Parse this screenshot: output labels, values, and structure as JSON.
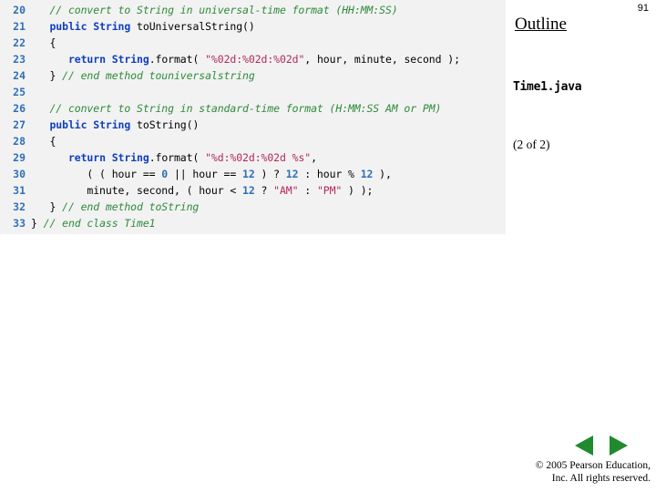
{
  "slide": {
    "number": "91",
    "outline_label": "Outline",
    "file_name": "Time1.java",
    "page_of": "(2 of 2)"
  },
  "code": {
    "lines": [
      {
        "num": "20",
        "tokens": [
          {
            "t": "   ",
            "c": "plain"
          },
          {
            "t": "// convert to String in universal-time format (HH:MM:SS)",
            "c": "comment"
          }
        ]
      },
      {
        "num": "21",
        "tokens": [
          {
            "t": "   ",
            "c": "plain"
          },
          {
            "t": "public",
            "c": "keyword"
          },
          {
            "t": " ",
            "c": "plain"
          },
          {
            "t": "String",
            "c": "type"
          },
          {
            "t": " toUniversalString()",
            "c": "plain"
          }
        ]
      },
      {
        "num": "22",
        "tokens": [
          {
            "t": "   {",
            "c": "plain"
          }
        ]
      },
      {
        "num": "23",
        "tokens": [
          {
            "t": "      ",
            "c": "plain"
          },
          {
            "t": "return",
            "c": "keyword"
          },
          {
            "t": " ",
            "c": "plain"
          },
          {
            "t": "String",
            "c": "type"
          },
          {
            "t": ".format( ",
            "c": "plain"
          },
          {
            "t": "\"%02d:%02d:%02d\"",
            "c": "string"
          },
          {
            "t": ", hour, minute, second );",
            "c": "plain"
          }
        ]
      },
      {
        "num": "24",
        "tokens": [
          {
            "t": "   } ",
            "c": "plain"
          },
          {
            "t": "// end method touniversalstring",
            "c": "comment"
          }
        ]
      },
      {
        "num": "25",
        "tokens": []
      },
      {
        "num": "26",
        "tokens": [
          {
            "t": "   ",
            "c": "plain"
          },
          {
            "t": "// convert to String in standard-time format (H:MM:SS AM or PM)",
            "c": "comment"
          }
        ]
      },
      {
        "num": "27",
        "tokens": [
          {
            "t": "   ",
            "c": "plain"
          },
          {
            "t": "public",
            "c": "keyword"
          },
          {
            "t": " ",
            "c": "plain"
          },
          {
            "t": "String",
            "c": "type"
          },
          {
            "t": " toString()",
            "c": "plain"
          }
        ]
      },
      {
        "num": "28",
        "tokens": [
          {
            "t": "   {",
            "c": "plain"
          }
        ]
      },
      {
        "num": "29",
        "tokens": [
          {
            "t": "      ",
            "c": "plain"
          },
          {
            "t": "return",
            "c": "keyword"
          },
          {
            "t": " ",
            "c": "plain"
          },
          {
            "t": "String",
            "c": "type"
          },
          {
            "t": ".format( ",
            "c": "plain"
          },
          {
            "t": "\"%d:%02d:%02d %s\"",
            "c": "string"
          },
          {
            "t": ",",
            "c": "plain"
          }
        ]
      },
      {
        "num": "30",
        "tokens": [
          {
            "t": "         ( ( hour == ",
            "c": "plain"
          },
          {
            "t": "0",
            "c": "number"
          },
          {
            "t": " || hour == ",
            "c": "plain"
          },
          {
            "t": "12",
            "c": "number"
          },
          {
            "t": " ) ? ",
            "c": "plain"
          },
          {
            "t": "12",
            "c": "number"
          },
          {
            "t": " : hour % ",
            "c": "plain"
          },
          {
            "t": "12",
            "c": "number"
          },
          {
            "t": " ),",
            "c": "plain"
          }
        ]
      },
      {
        "num": "31",
        "tokens": [
          {
            "t": "         minute, second, ( hour < ",
            "c": "plain"
          },
          {
            "t": "12",
            "c": "number"
          },
          {
            "t": " ? ",
            "c": "plain"
          },
          {
            "t": "\"AM\"",
            "c": "string"
          },
          {
            "t": " : ",
            "c": "plain"
          },
          {
            "t": "\"PM\"",
            "c": "string"
          },
          {
            "t": " ) );",
            "c": "plain"
          }
        ]
      },
      {
        "num": "32",
        "tokens": [
          {
            "t": "   } ",
            "c": "plain"
          },
          {
            "t": "// end method toString",
            "c": "comment"
          }
        ]
      },
      {
        "num": "33",
        "tokens": [
          {
            "t": "} ",
            "c": "plain"
          },
          {
            "t": "// end class Time1",
            "c": "comment"
          }
        ]
      }
    ]
  },
  "nav": {
    "prev_label": "previous-slide",
    "next_label": "next-slide",
    "arrow_color": "#1f8a2e"
  },
  "footer": {
    "line1": "© 2005 Pearson Education,",
    "line2": "Inc.  All rights reserved."
  }
}
